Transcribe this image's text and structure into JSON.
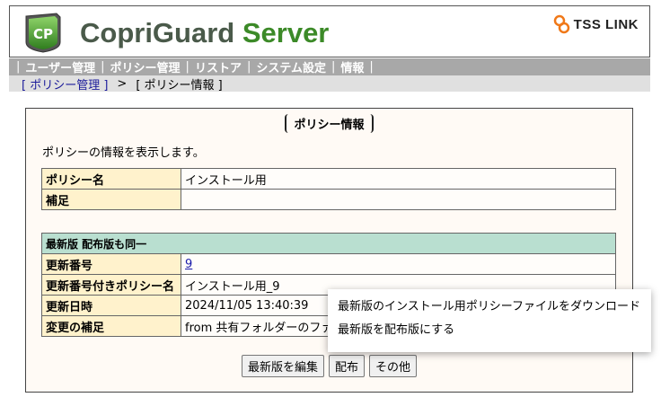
{
  "header": {
    "title_main": "CopriGuard ",
    "title_accent": "Server",
    "logo_text": "CP",
    "brand": "TSS LINK",
    "accent_color": "#3c8a28"
  },
  "nav": {
    "items": [
      "ユーザー管理",
      "ポリシー管理",
      "リストア",
      "システム設定",
      "情報"
    ]
  },
  "breadcrumb": {
    "parent": "[ ポリシー管理 ]",
    "arrow": ">",
    "current": "[ ポリシー情報 ]"
  },
  "panel": {
    "title": "ポリシー情報",
    "description": "ポリシーの情報を表示します。"
  },
  "policy_table": {
    "name_label": "ポリシー名",
    "name_value": "インストール用",
    "note_label": "補足",
    "note_value": ""
  },
  "version_table": {
    "header": "最新版 配布版も同一",
    "rows": [
      {
        "label": "更新番号",
        "value": "9"
      },
      {
        "label": "更新番号付きポリシー名",
        "value": "インストール用_9"
      },
      {
        "label": "更新日時",
        "value": "2024/11/05 13:40:39"
      },
      {
        "label": "変更の補足",
        "value": "from 共有フォルダーのファイル"
      }
    ]
  },
  "buttons": {
    "edit": "最新版を編集",
    "distribute": "配布",
    "other": "その他"
  },
  "popup": {
    "items": [
      "最新版のインストール用ポリシーファイルをダウンロード",
      "最新版を配布版にする"
    ]
  }
}
